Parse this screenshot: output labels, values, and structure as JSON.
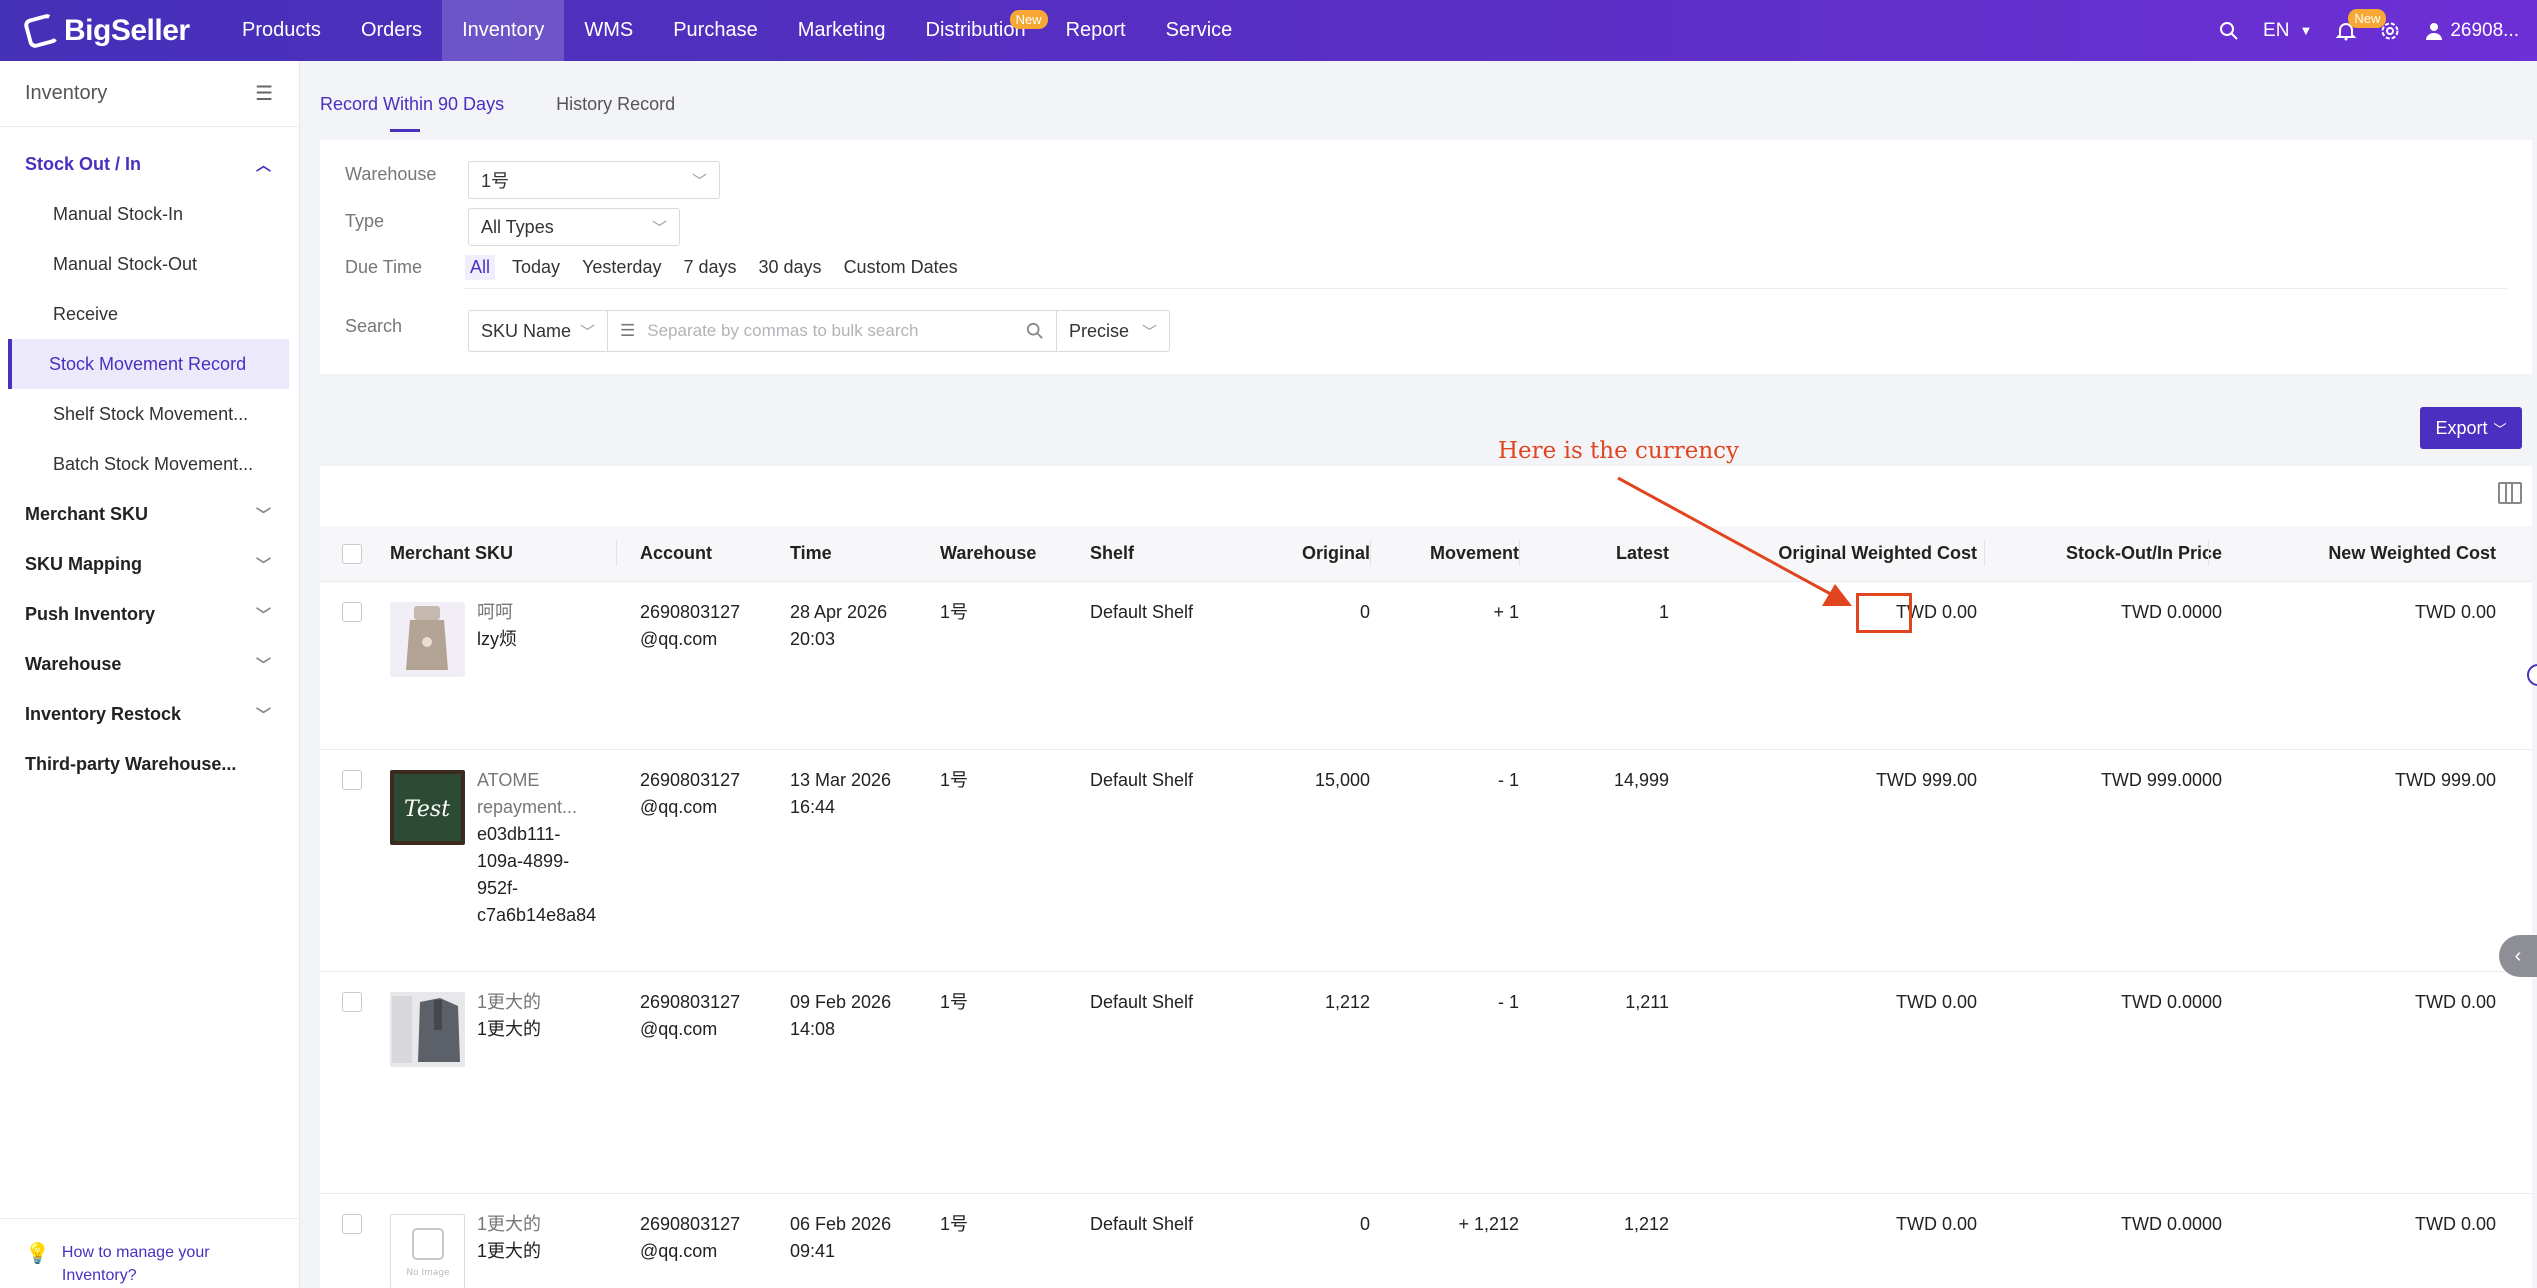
{
  "app": {
    "brand": "BigSeller",
    "nav": [
      {
        "label": "Products"
      },
      {
        "label": "Orders"
      },
      {
        "label": "Inventory"
      },
      {
        "label": "WMS"
      },
      {
        "label": "Purchase"
      },
      {
        "label": "Marketing"
      },
      {
        "label": "Distribution",
        "badge": "New"
      },
      {
        "label": "Report"
      },
      {
        "label": "Service"
      }
    ],
    "language": "EN",
    "notification_badge": "New",
    "user": "26908..."
  },
  "sidebar": {
    "title": "Inventory",
    "groups": [
      {
        "label": "Stock Out / In",
        "items": [
          "Manual Stock-In",
          "Manual Stock-Out",
          "Receive",
          "Stock Movement Record",
          "Shelf Stock Movement...",
          "Batch Stock Movement..."
        ]
      },
      {
        "label": "Merchant SKU"
      },
      {
        "label": "SKU Mapping"
      },
      {
        "label": "Push Inventory"
      },
      {
        "label": "Warehouse"
      },
      {
        "label": "Inventory Restock"
      },
      {
        "label": "Third-party Warehouse..."
      }
    ],
    "help": "How to manage your Inventory?"
  },
  "tabs": [
    "Record Within 90 Days",
    "History Record"
  ],
  "filters": {
    "warehouse_label": "Warehouse",
    "warehouse_value": "1号",
    "type_label": "Type",
    "type_value": "All Types",
    "due_label": "Due Time",
    "due_options": [
      "All",
      "Today",
      "Yesterday",
      "7 days",
      "30 days",
      "Custom Dates"
    ],
    "search_label": "Search",
    "search_field": "SKU Name",
    "search_placeholder": "Separate by commas to bulk search",
    "search_mode": "Precise"
  },
  "export_label": "Export",
  "annotation": "Here is the currency",
  "table": {
    "headers": {
      "sku": "Merchant SKU",
      "account": "Account",
      "time": "Time",
      "warehouse": "Warehouse",
      "shelf": "Shelf",
      "original": "Original",
      "movement": "Movement",
      "latest": "Latest",
      "owc": "Original Weighted Cost",
      "price": "Stock-Out/In Price",
      "nwc": "New Weighted Cost"
    },
    "rows": [
      {
        "sku_lines": [
          "呵呵",
          "lzy烦"
        ],
        "account": [
          "2690803127",
          "@qq.com"
        ],
        "time": [
          "28 Apr 2026",
          "20:03"
        ],
        "warehouse": "1号",
        "shelf": "Default Shelf",
        "original": "0",
        "movement": "+ 1",
        "latest": "1",
        "owc_cur": "TWD",
        "owc_val": "0.00",
        "price": "TWD 0.0000",
        "nwc": "TWD 0.00"
      },
      {
        "sku_lines": [
          "ATOME",
          "repayment...",
          "e03db111-",
          "109a-4899-",
          "952f-",
          "c7a6b14e8a84"
        ],
        "account": [
          "2690803127",
          "@qq.com"
        ],
        "time": [
          "13 Mar 2026",
          "16:44"
        ],
        "warehouse": "1号",
        "shelf": "Default Shelf",
        "original": "15,000",
        "movement": "- 1",
        "latest": "14,999",
        "owc_cur": "TWD",
        "owc_val": "999.00",
        "price": "TWD 999.0000",
        "nwc": "TWD 999.00"
      },
      {
        "sku_lines": [
          "1更大的",
          "1更大的"
        ],
        "account": [
          "2690803127",
          "@qq.com"
        ],
        "time": [
          "09 Feb 2026",
          "14:08"
        ],
        "warehouse": "1号",
        "shelf": "Default Shelf",
        "original": "1,212",
        "movement": "- 1",
        "latest": "1,211",
        "owc_cur": "TWD",
        "owc_val": "0.00",
        "price": "TWD 0.0000",
        "nwc": "TWD 0.00"
      },
      {
        "sku_lines": [
          "1更大的",
          "1更大的"
        ],
        "account": [
          "2690803127",
          "@qq.com"
        ],
        "time": [
          "06 Feb 2026",
          "09:41"
        ],
        "warehouse": "1号",
        "shelf": "Default Shelf",
        "original": "0",
        "movement": "+ 1,212",
        "latest": "1,212",
        "owc_cur": "TWD",
        "owc_val": "0.00",
        "price": "TWD 0.0000",
        "nwc": "TWD 0.00"
      }
    ],
    "thumb_labels": {
      "test_board": "Test",
      "no_image": "No Image"
    }
  }
}
